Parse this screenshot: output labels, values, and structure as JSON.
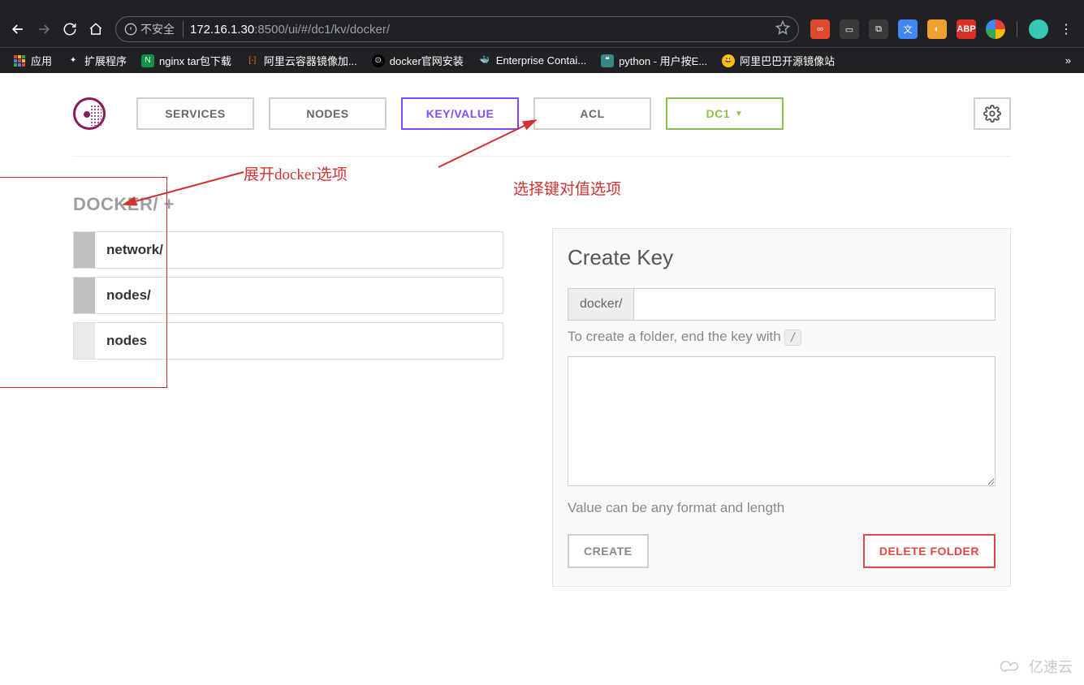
{
  "browser": {
    "security_label": "不安全",
    "url_host": "172.16.1.30",
    "url_port": ":8500",
    "url_path": "/ui/#/dc1/kv/docker/"
  },
  "bookmarks": {
    "apps": "应用",
    "items": [
      {
        "label": "扩展程序"
      },
      {
        "label": "nginx tar包下载"
      },
      {
        "label": "阿里云容器镜像加..."
      },
      {
        "label": "docker官网安装"
      },
      {
        "label": "Enterprise Contai..."
      },
      {
        "label": "python - 用户按E..."
      },
      {
        "label": "阿里巴巴开源镜像站"
      }
    ]
  },
  "nav": {
    "services": "SERVICES",
    "nodes": "NODES",
    "keyvalue": "KEY/VALUE",
    "acl": "ACL",
    "dc": "DC1"
  },
  "annotations": {
    "expand": "展开docker选项",
    "select_kv": "选择键对值选项"
  },
  "kv": {
    "breadcrumb": "DOCKER/",
    "plus": "+",
    "items": [
      {
        "name": "network/",
        "folder": true
      },
      {
        "name": "nodes/",
        "folder": true
      },
      {
        "name": "nodes",
        "folder": false
      }
    ]
  },
  "form": {
    "title": "Create Key",
    "prefix": "docker/",
    "hint_pre": "To create a folder, end the key with ",
    "hint_code": "/",
    "value_hint": "Value can be any format and length",
    "create": "CREATE",
    "delete": "DELETE FOLDER"
  },
  "watermark": "亿速云"
}
